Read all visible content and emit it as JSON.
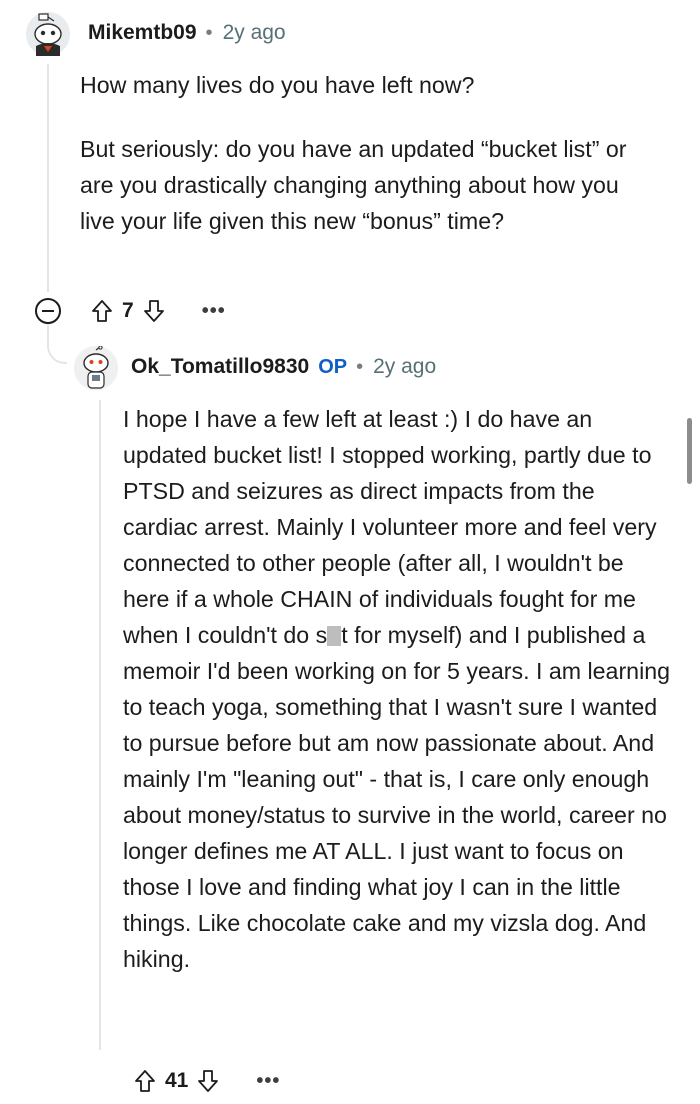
{
  "comment1": {
    "username": "Mikemtb09",
    "separator": "•",
    "time_ago": "2y ago",
    "paragraphs": [
      "How many lives do you have left now?",
      "But seriously: do you have an updated “bucket list” or are you drastically changing anything about how you live your life given this new “bonus” time?"
    ],
    "votes": "7",
    "avatar_icon": "snoo-avatar-icon",
    "upvote_icon": "arrow-up-outline-icon",
    "downvote_icon": "arrow-down-outline-icon",
    "more_icon": "ellipsis-icon",
    "more_label": "•••",
    "collapse_icon": "minus-circle-icon"
  },
  "comment2": {
    "username": "Ok_Tomatillo9830",
    "op_badge": "OP",
    "separator": "•",
    "time_ago": "2y ago",
    "text_before_redaction": "I hope I have a few left at least :) I do have an updated bucket list! I stopped working, partly due to PTSD and seizures as direct impacts from the cardiac arrest. Mainly I volunteer more and feel very connected to other people (after all, I wouldn't be here if a whole CHAIN of individuals fought for me when I couldn't do s",
    "text_after_redaction": "t for myself) and I published a memoir I'd been working on for 5 years. I am learning to teach yoga, something that I wasn't sure I wanted to pursue before but am now passionate about. And mainly I'm \"leaning out\" - that is, I care only enough about money/status to survive in the world, career no longer defines me AT ALL. I just want to focus on those I love and finding what joy I can in the little things. Like chocolate cake and my vizsla dog. And hiking.",
    "votes": "41",
    "avatar_icon": "snoo-avatar-icon",
    "upvote_icon": "arrow-up-outline-icon",
    "downvote_icon": "arrow-down-outline-icon",
    "more_icon": "ellipsis-icon",
    "more_label": "•••"
  },
  "colors": {
    "op_badge": "#0f5fc7",
    "thread_line": "#e3e5e8",
    "meta_text": "#576f76"
  }
}
